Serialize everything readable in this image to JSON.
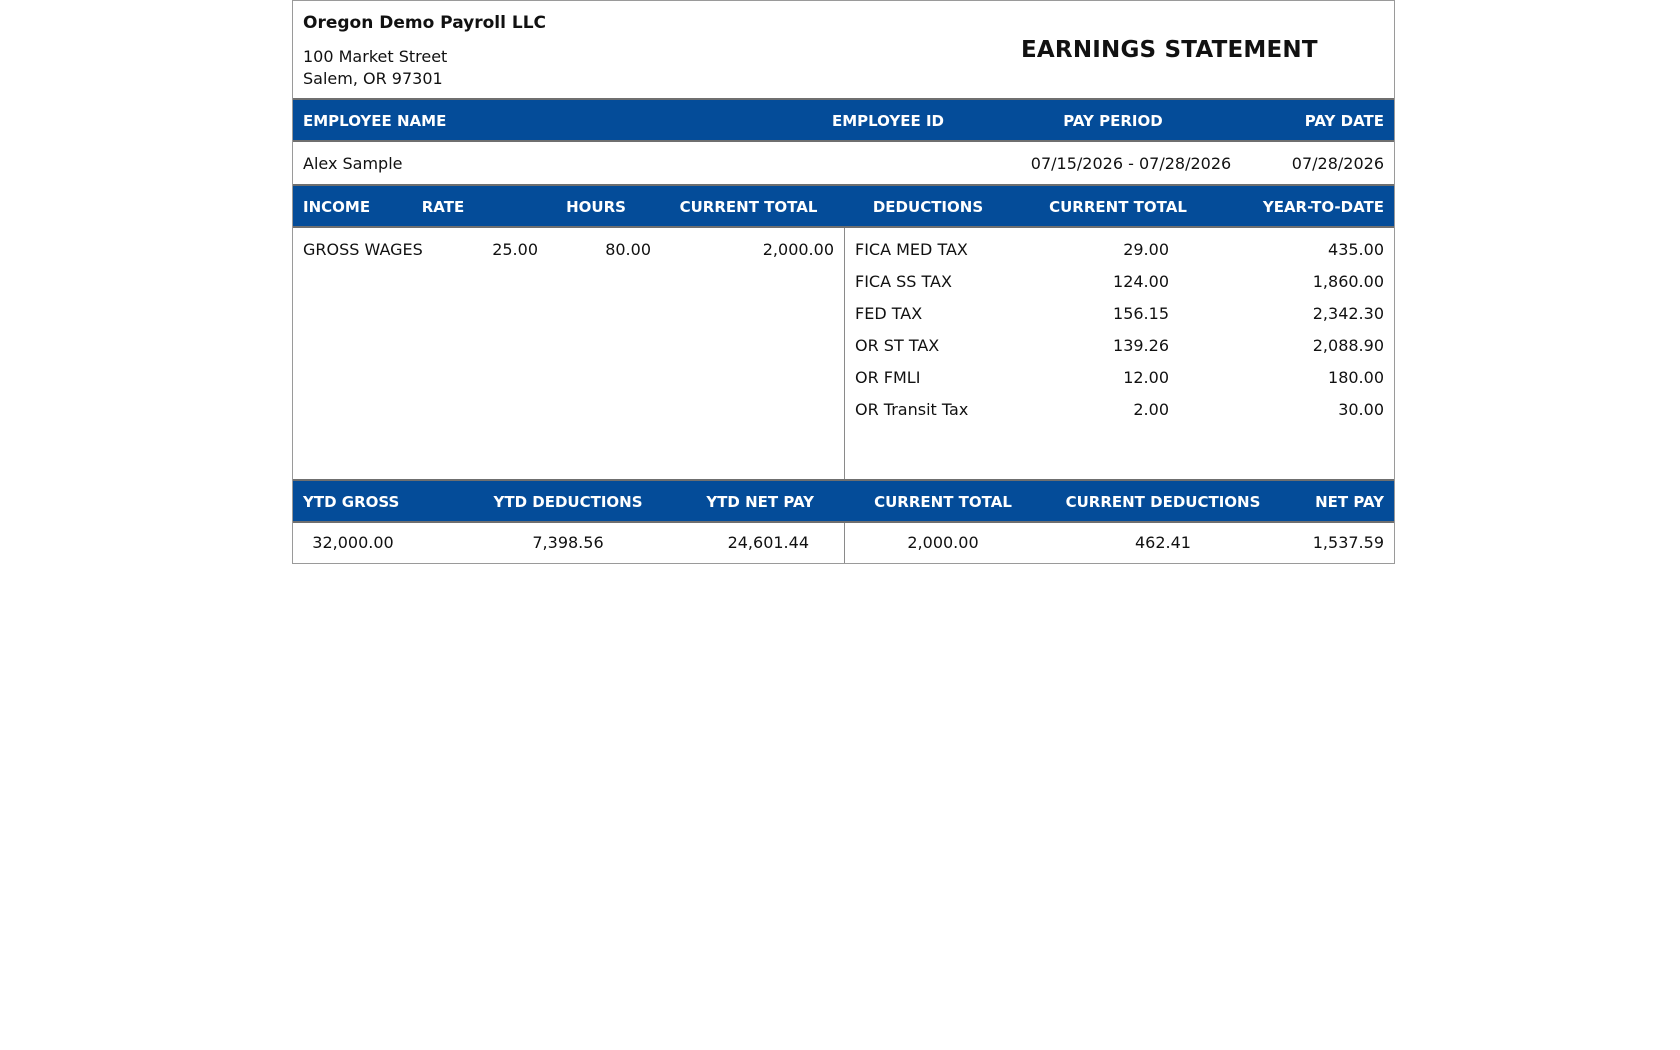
{
  "company": {
    "name": "Oregon Demo Payroll LLC",
    "address_line1": "100 Market Street",
    "address_line2": "Salem, OR 97301"
  },
  "title": "EARNINGS STATEMENT",
  "employee_header": {
    "name_label": "EMPLOYEE NAME",
    "id_label": "EMPLOYEE ID",
    "period_label": "PAY PERIOD",
    "date_label": "PAY DATE"
  },
  "employee": {
    "name": "Alex Sample",
    "id": "",
    "pay_period": "07/15/2026 - 07/28/2026",
    "pay_date": "07/28/2026"
  },
  "detail_header": {
    "income": "INCOME",
    "rate": "RATE",
    "hours": "HOURS",
    "income_current_total": "CURRENT TOTAL",
    "deductions": "DEDUCTIONS",
    "deduction_current_total": "CURRENT TOTAL",
    "ytd": "YEAR-TO-DATE"
  },
  "income": [
    {
      "label": "GROSS WAGES",
      "rate": "25.00",
      "hours": "80.00",
      "current_total": "2,000.00"
    }
  ],
  "deductions": [
    {
      "label": "FICA MED TAX",
      "current_total": "29.00",
      "ytd": "435.00"
    },
    {
      "label": "FICA SS TAX",
      "current_total": "124.00",
      "ytd": "1,860.00"
    },
    {
      "label": "FED TAX",
      "current_total": "156.15",
      "ytd": "2,342.30"
    },
    {
      "label": "OR ST TAX",
      "current_total": "139.26",
      "ytd": "2,088.90"
    },
    {
      "label": "OR FMLI",
      "current_total": "12.00",
      "ytd": "180.00"
    },
    {
      "label": "OR Transit Tax",
      "current_total": "2.00",
      "ytd": "30.00"
    }
  ],
  "totals_header": {
    "ytd_gross": "YTD GROSS",
    "ytd_deductions": "YTD DEDUCTIONS",
    "ytd_net_pay": "YTD NET PAY",
    "current_total": "CURRENT TOTAL",
    "current_deductions": "CURRENT DEDUCTIONS",
    "net_pay": "NET PAY"
  },
  "totals": {
    "ytd_gross": "32,000.00",
    "ytd_deductions": "7,398.56",
    "ytd_net_pay": "24,601.44",
    "current_total": "2,000.00",
    "current_deductions": "462.41",
    "net_pay": "1,537.59"
  },
  "colors": {
    "header_bar": "#044c99",
    "header_text": "#ffffff",
    "border": "#6f6f6f"
  }
}
